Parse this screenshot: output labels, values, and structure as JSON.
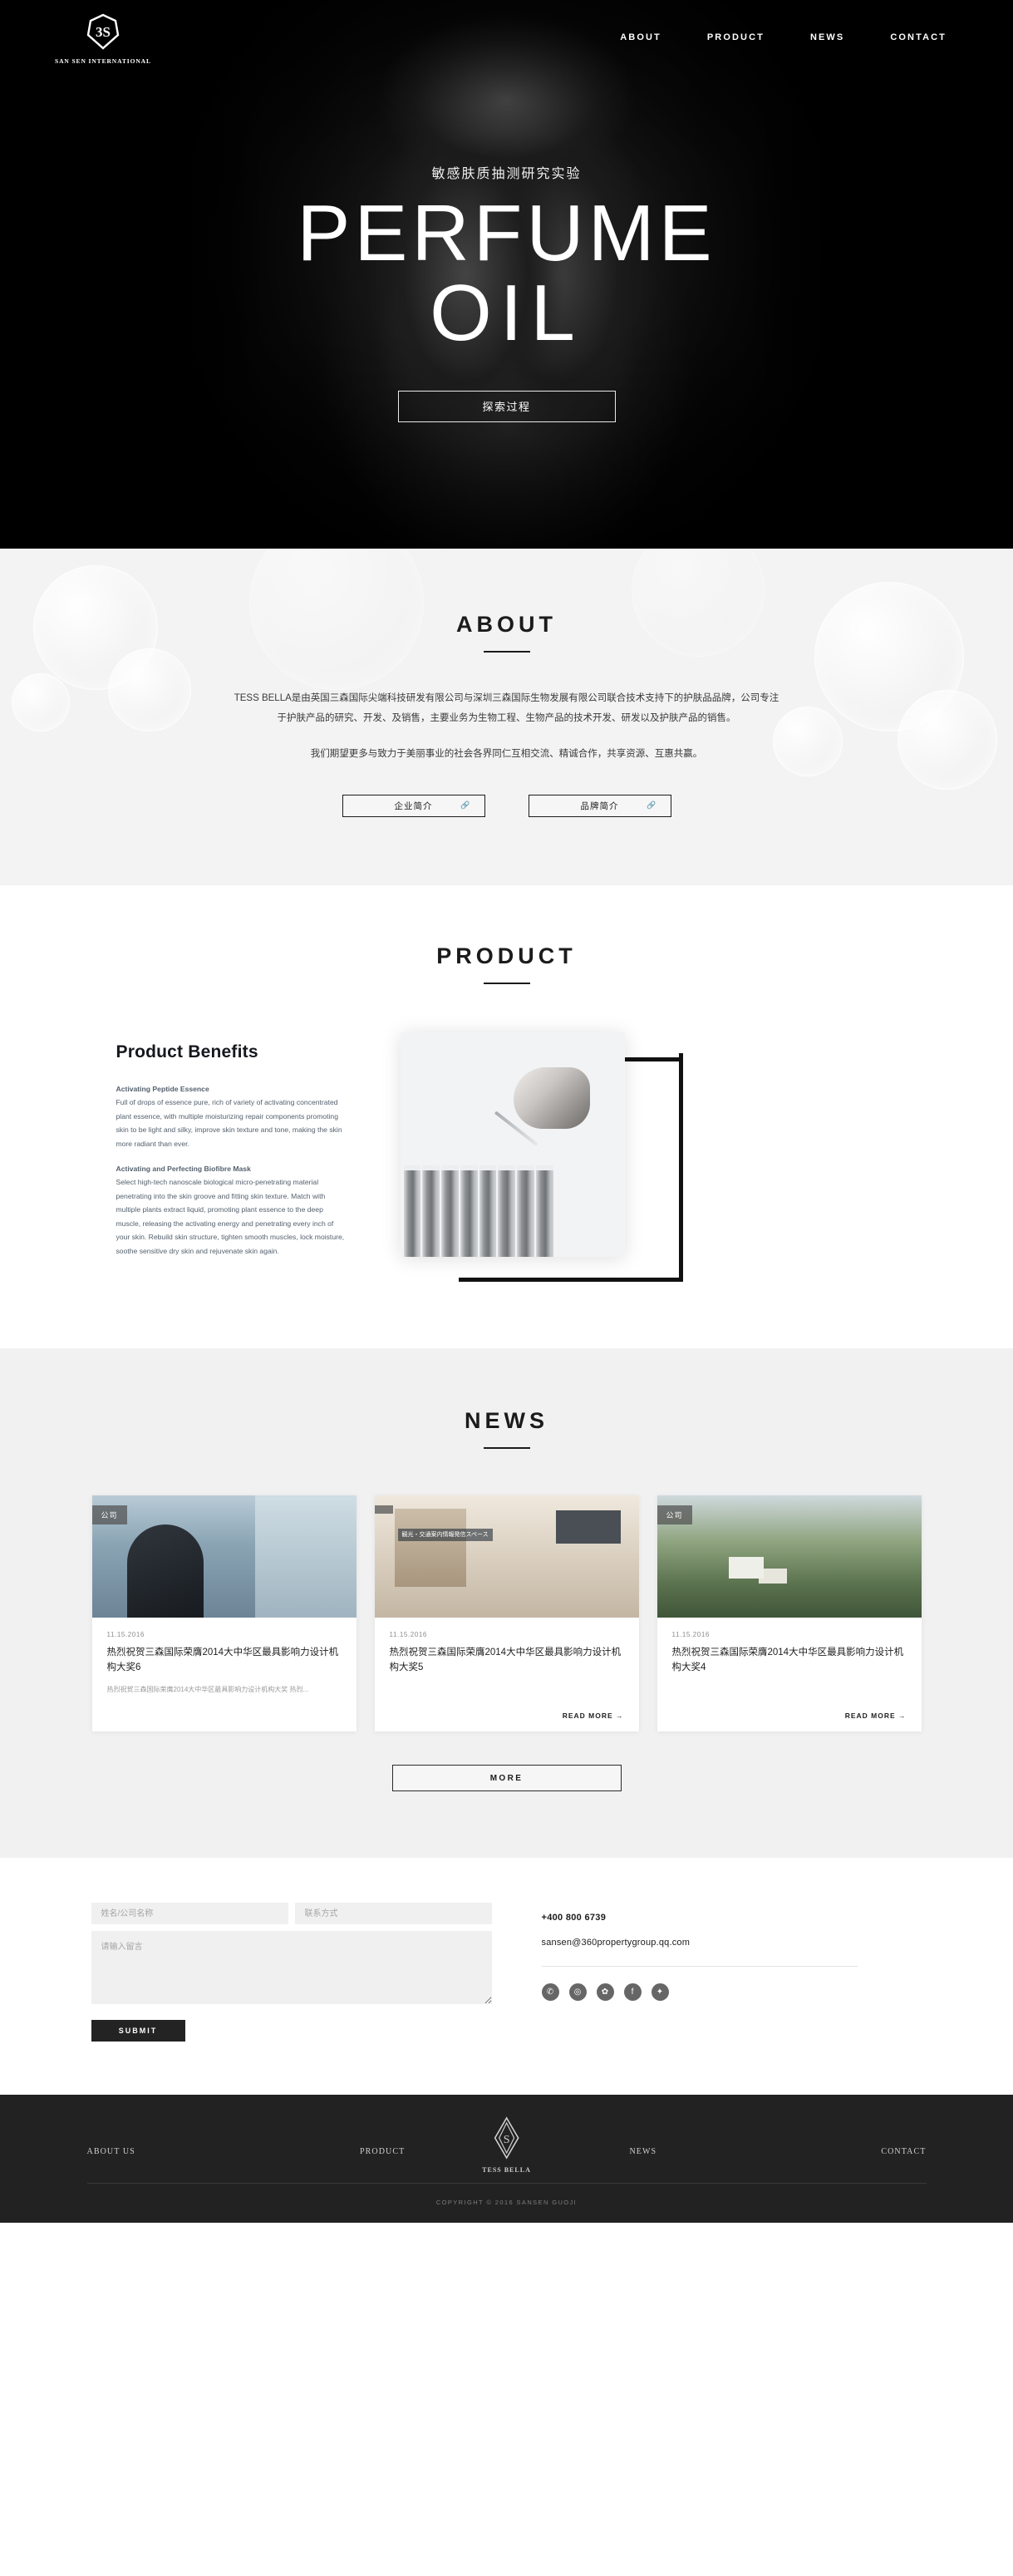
{
  "brand": {
    "mark_icon": "3s-hexagon-logo-icon",
    "name": "SAN SEN INTERNATIONAL",
    "footer_logo_icon": "tess-bella-diamond-logo-icon",
    "footer_name": "TESS BELLA"
  },
  "nav": {
    "items": [
      {
        "label": "ABOUT"
      },
      {
        "label": "PRODUCT"
      },
      {
        "label": "NEWS"
      },
      {
        "label": "CONTACT"
      }
    ]
  },
  "hero": {
    "subtitle": "敏感肤质抽测研究实验",
    "title_line1": "PERFUME",
    "title_line2": "OIL",
    "cta_label": "探索过程"
  },
  "about": {
    "title": "ABOUT",
    "paragraph1": "TESS BELLA是由英国三森国际尖端科技研发有限公司与深圳三森国际生物发展有限公司联合技术支持下的护肤品品牌，公司专注于护肤产品的研究、开发、及销售，主要业务为生物工程、生物产品的技术开发、研发以及护肤产品的销售。",
    "paragraph2": "我们期望更多与致力于美丽事业的社会各界同仁互相交流、精诚合作，共享资源、互惠共赢。",
    "buttons": [
      {
        "label": "企业简介",
        "icon": "link-icon"
      },
      {
        "label": "品牌简介",
        "icon": "link-icon"
      }
    ]
  },
  "product": {
    "title": "PRODUCT",
    "heading": "Product Benefits",
    "block1_title": "Activating Peptide Essence",
    "block1_body": "Full of drops of essence pure, rich of variety of activating concentrated plant essence, with multiple moisturizing repair components promoting skin to be light and silky, improve skin texture and tone, making the skin more radiant than ever.",
    "block2_title": "Activating and Perfecting Biofibre Mask",
    "block2_body": "Select high-tech nanoscale biological micro-penetrating material penetrating into the skin groove and fitting skin texture. Match with multiple plants extract liquid, promoting plant essence to the deep muscle, releasing the activating energy and penetrating every inch of your skin. Rebuild skin structure, tighten smooth muscles, lock moisture, soothe sensitive dry skin and rejuvenate skin again.",
    "image_alt": "dropper-and-test-tubes-photo"
  },
  "news": {
    "title": "NEWS",
    "more_label": "MORE",
    "cards": [
      {
        "tag": "公司",
        "date": "11.15.2016",
        "title": "热烈祝贺三森国际荣膺2014大中华区最具影响力设计机构大奖6",
        "excerpt": "热烈祝贺三森国际荣膺2014大中华区最具影响力设计机构大奖 热烈...",
        "read_more": "",
        "image_name": "man-at-window-photo",
        "overlay": ""
      },
      {
        "tag": "",
        "date": "11.15.2016",
        "title": "热烈祝贺三森国际荣膺2014大中华区最具影响力设计机构大奖5",
        "excerpt": "",
        "read_more": "READ MORE →",
        "image_name": "station-interior-photo",
        "overlay": "観光・交通案内情報発信スペース"
      },
      {
        "tag": "公司",
        "date": "11.15.2016",
        "title": "热烈祝贺三森国际荣膺2014大中华区最具影响力设计机构大奖4",
        "excerpt": "",
        "read_more": "READ MORE →",
        "image_name": "hillside-houses-photo",
        "overlay": ""
      }
    ]
  },
  "contact": {
    "name_placeholder": "姓名/公司名称",
    "contact_placeholder": "联系方式",
    "message_placeholder": "请输入留言",
    "name_value": "",
    "contact_value": "",
    "message_value": "",
    "submit_label": "SUBMIT",
    "phone": "+400 800 6739",
    "email": "sansen@360propertygroup.qq.com",
    "socials": [
      {
        "name": "wechat-icon",
        "glyph": "✆"
      },
      {
        "name": "weibo-icon",
        "glyph": "◎"
      },
      {
        "name": "qq-icon",
        "glyph": "✿"
      },
      {
        "name": "facebook-icon",
        "glyph": "f"
      },
      {
        "name": "twitter-icon",
        "glyph": "✦"
      }
    ]
  },
  "footer": {
    "links": [
      {
        "label": "ABOUT US"
      },
      {
        "label": "PRODUCT"
      },
      {
        "label": "NEWS"
      },
      {
        "label": "CONTACT"
      }
    ],
    "copyright": "COPYRIGHT © 2016 SANSEN GUOJI"
  },
  "colors": {
    "hero_bg": "#050505",
    "about_bg": "#f3f3f3",
    "news_bg": "#f1f1f1",
    "footer_bg": "#222222",
    "accent": "#1b1b1b"
  }
}
